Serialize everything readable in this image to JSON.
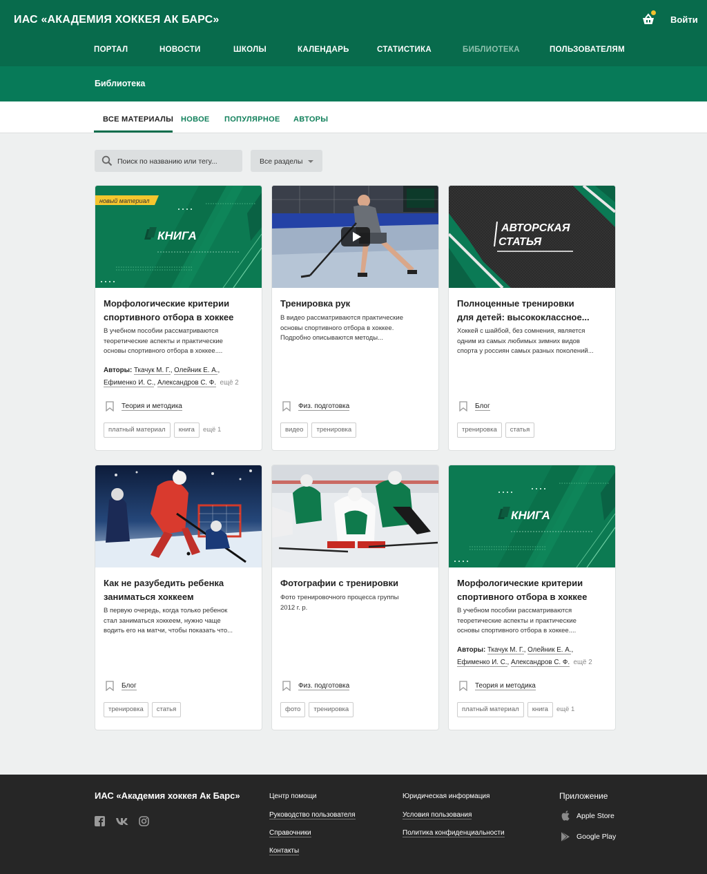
{
  "header": {
    "brand": "ИАС «АКАДЕМИЯ ХОККЕЯ АК БАРС»",
    "login": "Войти",
    "nav": [
      "ПОРТАЛ",
      "НОВОСТИ",
      "ШКОЛЫ",
      "КАЛЕНДАРЬ",
      "СТАТИСТИКА",
      "БИБЛИОТЕКА",
      "ПОЛЬЗОВАТЕЛЯМ"
    ],
    "nav_active": "БИБЛИОТЕКА"
  },
  "subheader": {
    "title": "Библиотека"
  },
  "tabs": [
    "ВСЕ МАТЕРИАЛЫ",
    "НОВОЕ",
    "ПОПУЛЯРНОЕ",
    "АВТОРЫ"
  ],
  "filters": {
    "search_placeholder": "Поиск по названию или тегу...",
    "section": "Все разделы"
  },
  "cards": [
    {
      "badge": "новый материал",
      "thumb_label": "КНИГА",
      "title": [
        "Морфологические критерии",
        "спортивного отбора в хоккее"
      ],
      "desc": [
        "В учебном пособии рассматриваются",
        "теоретические аспекты и практические",
        "основы спортивного отбора в хоккее...."
      ],
      "authors_label": "Авторы:",
      "authors": [
        "Ткачук М. Г.",
        "Олейник Е. А.",
        "Ефименко И. С.",
        "Александров С. Ф."
      ],
      "authors_more": "ещё 2",
      "category": "Теория и методика",
      "tags": [
        "платный материал",
        "книга"
      ],
      "tags_more": "ещё 1"
    },
    {
      "title": [
        "Тренировка рук"
      ],
      "desc": [
        "В видео рассматриваются практические",
        "основы спортивного отбора в хоккее.",
        "Подробно описываются методы..."
      ],
      "category": "Физ. подготовка",
      "tags": [
        "видео",
        "тренировка"
      ]
    },
    {
      "thumb_label": [
        "АВТОРСКАЯ",
        "СТАТЬЯ"
      ],
      "title": [
        "Полноценные тренировки",
        "для детей: высококлассное..."
      ],
      "desc": [
        "Хоккей с шайбой, без сомнения, является",
        "одним из самых любимых зимних видов",
        "спорта у россиян самых разных поколений..."
      ],
      "category": "Блог",
      "tags": [
        "тренировка",
        "статья"
      ]
    },
    {
      "title": [
        "Как не разубедить ребенка",
        "заниматься хоккеем"
      ],
      "desc": [
        "В первую очередь, когда только ребенок",
        "стал заниматься хоккеем, нужно чаще",
        "водить его на матчи, чтобы показать что..."
      ],
      "category": "Блог",
      "tags": [
        "тренировка",
        "статья"
      ]
    },
    {
      "title": [
        "Фотографии с тренировки"
      ],
      "desc": [
        "Фото тренировочного процесса группы",
        "2012 г. р."
      ],
      "category": "Физ. подготовка",
      "tags": [
        "фото",
        "тренировка"
      ]
    },
    {
      "thumb_label": "КНИГА",
      "title": [
        "Морфологические критерии",
        "спортивного отбора в хоккее"
      ],
      "desc": [
        "В учебном пособии рассматриваются",
        "теоретические аспекты и практические",
        "основы спортивного отбора в хоккее...."
      ],
      "authors_label": "Авторы:",
      "authors": [
        "Ткачук М. Г.",
        "Олейник Е. А.",
        "Ефименко И. С.",
        "Александров С. Ф."
      ],
      "authors_more": "ещё 2",
      "category": "Теория и методика",
      "tags": [
        "платный материал",
        "книга"
      ],
      "tags_more": "ещё 1"
    }
  ],
  "footer": {
    "brand": "ИАС «Академия хоккея Ак Барс»",
    "col1": [
      "Центр помощи",
      "Руководство пользователя",
      "Справочники",
      "Контакты"
    ],
    "col2": [
      "Юридическая информация",
      "Условия пользования",
      "Политика конфиденциальности"
    ],
    "app_title": "Приложение",
    "stores": [
      "Apple Store",
      "Google Play"
    ]
  },
  "colors": {
    "primary": "#086b4c",
    "secondary": "#077a58",
    "accent": "#f2c12e",
    "footer": "#262626"
  }
}
